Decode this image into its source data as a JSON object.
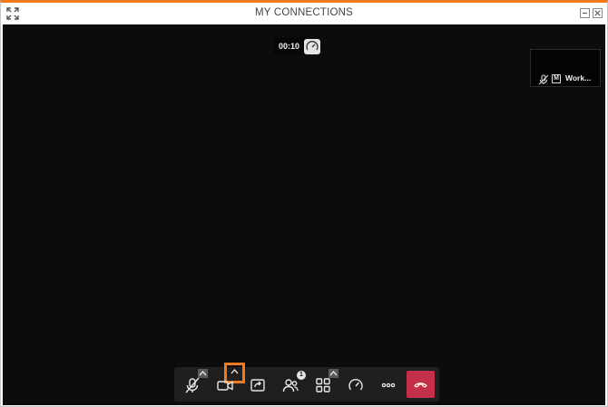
{
  "window": {
    "title": "MY CONNECTIONS",
    "accent_color": "#f07a1c",
    "icons": [
      "expand-icon",
      "minimize-icon",
      "close-icon"
    ]
  },
  "call": {
    "elapsed": "00:10",
    "background_color": "#0d0b0b",
    "participant_tile": {
      "badge": "M",
      "name": "Work...",
      "mic_state": "muted"
    }
  },
  "toolbar": {
    "participants_count": "1",
    "hangup_color": "#c4304a",
    "buttons": [
      {
        "icon": "mic-muted-icon",
        "caret": true
      },
      {
        "icon": "camera-icon",
        "caret": true,
        "caret_highlighted": true
      },
      {
        "icon": "share-screen-icon",
        "caret": false
      },
      {
        "icon": "participants-icon",
        "caret": false
      },
      {
        "icon": "layout-grid-icon",
        "caret": true
      },
      {
        "icon": "gauge-icon",
        "caret": false
      },
      {
        "icon": "more-icon",
        "caret": false
      },
      {
        "icon": "hangup-icon",
        "caret": false
      }
    ]
  }
}
